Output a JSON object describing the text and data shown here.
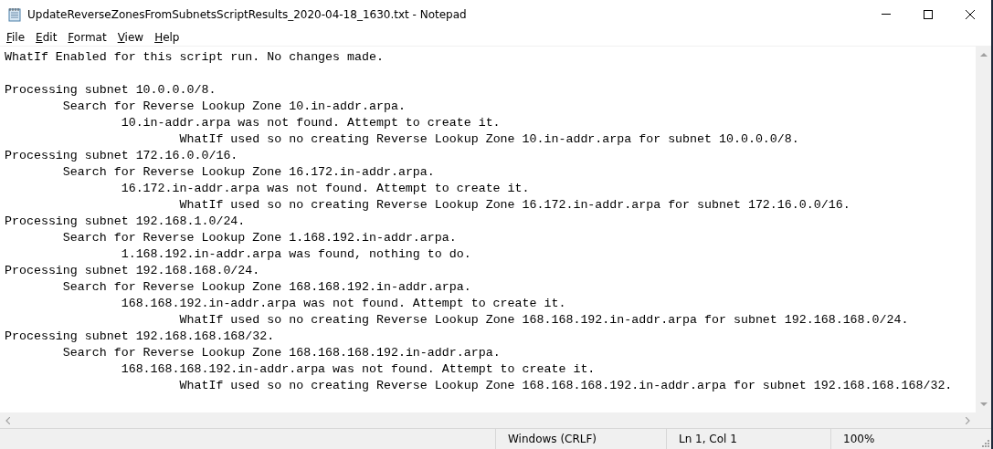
{
  "window": {
    "title": "UpdateReverseZonesFromSubnetsScriptResults_2020-04-18_1630.txt - Notepad"
  },
  "menu": [
    {
      "label": "File"
    },
    {
      "label": "Edit"
    },
    {
      "label": "Format"
    },
    {
      "label": "View"
    },
    {
      "label": "Help"
    }
  ],
  "editor": {
    "text": "WhatIf Enabled for this script run. No changes made.\n\nProcessing subnet 10.0.0.0/8.\n\tSearch for Reverse Lookup Zone 10.in-addr.arpa.\n\t\t10.in-addr.arpa was not found. Attempt to create it.\n\t\t\tWhatIf used so no creating Reverse Lookup Zone 10.in-addr.arpa for subnet 10.0.0.0/8.\nProcessing subnet 172.16.0.0/16.\n\tSearch for Reverse Lookup Zone 16.172.in-addr.arpa.\n\t\t16.172.in-addr.arpa was not found. Attempt to create it.\n\t\t\tWhatIf used so no creating Reverse Lookup Zone 16.172.in-addr.arpa for subnet 172.16.0.0/16.\nProcessing subnet 192.168.1.0/24.\n\tSearch for Reverse Lookup Zone 1.168.192.in-addr.arpa.\n\t\t1.168.192.in-addr.arpa was found, nothing to do.\nProcessing subnet 192.168.168.0/24.\n\tSearch for Reverse Lookup Zone 168.168.192.in-addr.arpa.\n\t\t168.168.192.in-addr.arpa was not found. Attempt to create it.\n\t\t\tWhatIf used so no creating Reverse Lookup Zone 168.168.192.in-addr.arpa for subnet 192.168.168.0/24.\nProcessing subnet 192.168.168.168/32.\n\tSearch for Reverse Lookup Zone 168.168.168.192.in-addr.arpa.\n\t\t168.168.168.192.in-addr.arpa was not found. Attempt to create it.\n\t\t\tWhatIf used so no creating Reverse Lookup Zone 168.168.168.192.in-addr.arpa for subnet 192.168.168.168/32."
  },
  "status_bar": {
    "line_ending": "Windows (CRLF)",
    "position": "Ln 1, Col 1",
    "zoom": "100%"
  }
}
